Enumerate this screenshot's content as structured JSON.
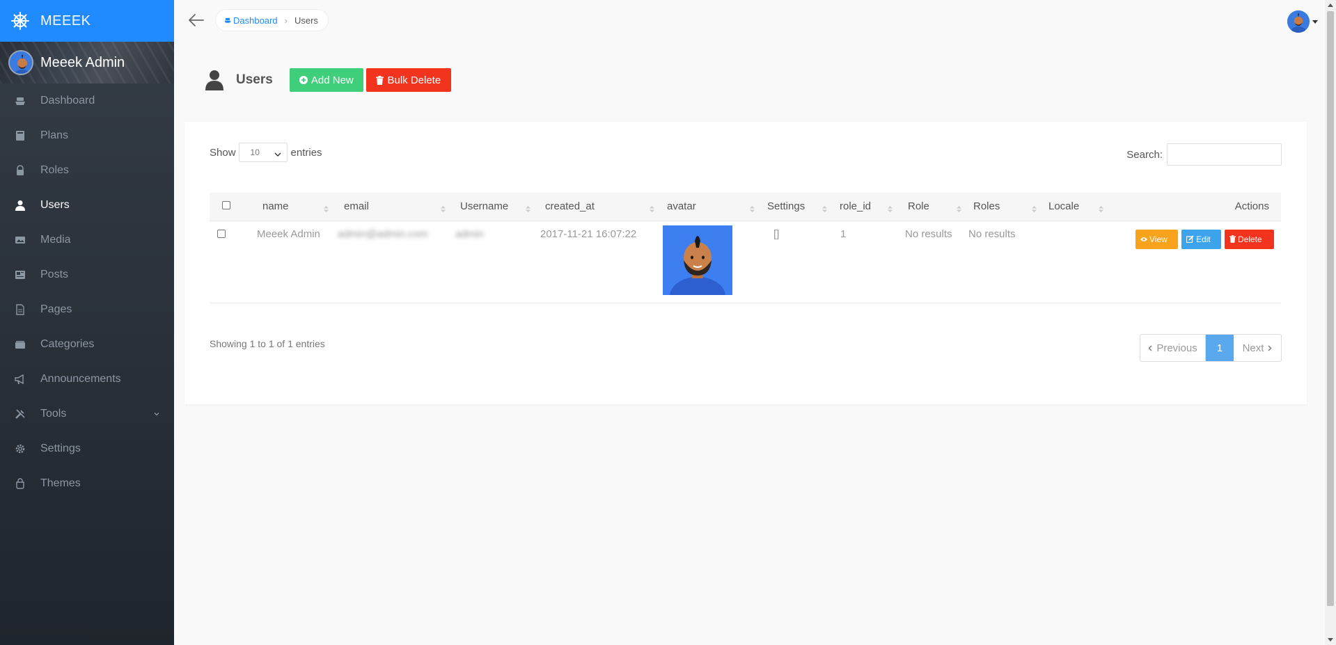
{
  "brand": {
    "name": "MEEEK",
    "logo_icon": "ship-wheel-icon"
  },
  "profile": {
    "name": "Meeek Admin"
  },
  "sidebar": {
    "items": [
      {
        "label": "Dashboard",
        "icon": "boat-icon",
        "active": false
      },
      {
        "label": "Plans",
        "icon": "book-icon",
        "active": false
      },
      {
        "label": "Roles",
        "icon": "lock-icon",
        "active": false
      },
      {
        "label": "Users",
        "icon": "person-icon",
        "active": true
      },
      {
        "label": "Media",
        "icon": "images-icon",
        "active": false
      },
      {
        "label": "Posts",
        "icon": "news-icon",
        "active": false
      },
      {
        "label": "Pages",
        "icon": "document-icon",
        "active": false
      },
      {
        "label": "Categories",
        "icon": "categories-icon",
        "active": false
      },
      {
        "label": "Announcements",
        "icon": "megaphone-icon",
        "active": false
      },
      {
        "label": "Tools",
        "icon": "tools-icon",
        "active": false,
        "has_submenu": true
      },
      {
        "label": "Settings",
        "icon": "gear-icon",
        "active": false
      },
      {
        "label": "Themes",
        "icon": "paint-bucket-icon",
        "active": false
      }
    ]
  },
  "breadcrumb": {
    "home": "Dashboard",
    "current": "Users"
  },
  "header": {
    "title": "Users",
    "add_label": "Add New",
    "bulk_delete_label": "Bulk Delete"
  },
  "table_controls": {
    "show_label": "Show",
    "entries_label": "entries",
    "page_length": "10",
    "search_label": "Search:",
    "search_value": ""
  },
  "table": {
    "columns": [
      "name",
      "email",
      "Username",
      "created_at",
      "avatar",
      "Settings",
      "role_id",
      "Role",
      "Roles",
      "Locale",
      "Actions"
    ],
    "rows": [
      {
        "name": "Meeek Admin",
        "email": "admin@admin.com",
        "username": "admin",
        "created_at": "2017-11-21 16:07:22",
        "settings": "[]",
        "role_id": "1",
        "role": "No results",
        "roles": "No results",
        "locale": ""
      }
    ],
    "row_actions": {
      "view": "View",
      "edit": "Edit",
      "delete": "Delete"
    }
  },
  "footer": {
    "info": "Showing 1 to 1 of 1 entries",
    "prev": "Previous",
    "page": "1",
    "next": "Next"
  },
  "colors": {
    "brand_blue": "#1f8bff",
    "sidebar_dark": "#2b323a",
    "add_green": "#3fcf7a",
    "delete_red": "#f2331e",
    "view_orange": "#f9a21b",
    "edit_blue": "#3da3ea",
    "page_active": "#5aa9ee"
  }
}
